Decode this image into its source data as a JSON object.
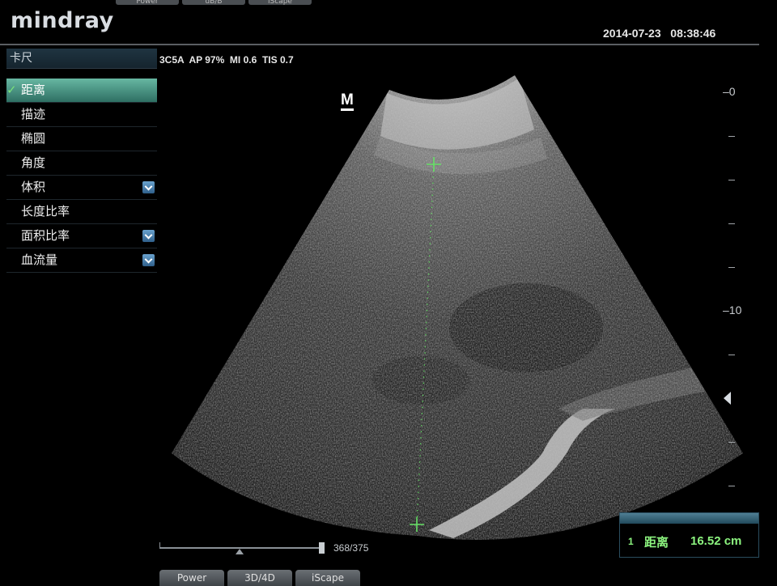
{
  "header": {
    "logo_text": "mindray",
    "datetime": "2014-07-23   08:38:46",
    "top_buttons": [
      "Power",
      "dB/B",
      "iScape"
    ]
  },
  "params": "3C5A  AP 97%  MI 0.6  TIS 0.7",
  "menu": {
    "title": "卡尺",
    "items": [
      {
        "label": "距离",
        "selected": true,
        "checked": true,
        "has_submenu": false
      },
      {
        "label": "描迹",
        "selected": false,
        "checked": false,
        "has_submenu": false
      },
      {
        "label": "椭圆",
        "selected": false,
        "checked": false,
        "has_submenu": false
      },
      {
        "label": "角度",
        "selected": false,
        "checked": false,
        "has_submenu": false
      },
      {
        "label": "体积",
        "selected": false,
        "checked": false,
        "has_submenu": true
      },
      {
        "label": "长度比率",
        "selected": false,
        "checked": false,
        "has_submenu": false
      },
      {
        "label": "面积比率",
        "selected": false,
        "checked": false,
        "has_submenu": true
      },
      {
        "label": "血流量",
        "selected": false,
        "checked": false,
        "has_submenu": true
      }
    ]
  },
  "image": {
    "marker": "M",
    "depth_labels": [
      "0",
      "10"
    ],
    "caliper_color": "#66e066"
  },
  "cine": {
    "frame_counter": "368/375",
    "progress": 0.49
  },
  "bottom_buttons": [
    "Power",
    "3D/4D",
    "iScape"
  ],
  "result": {
    "index": "1",
    "name": "距离",
    "value": "16.52 cm"
  },
  "colors": {
    "accent_teal": "#4f9e8c",
    "result_green": "#8cf47f",
    "submenu_blue": "#3f78a8"
  }
}
